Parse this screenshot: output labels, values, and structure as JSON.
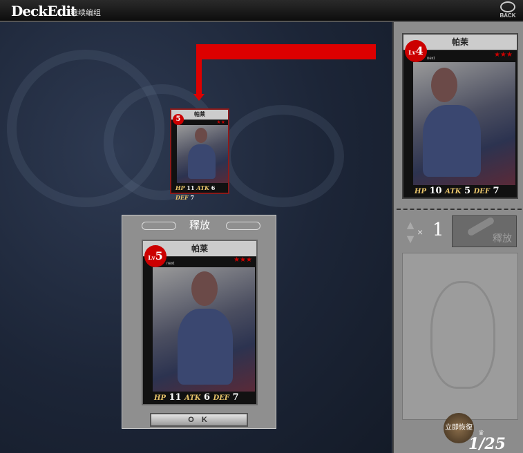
{
  "header": {
    "title": "DeckEdit",
    "subtitle": "继续编组",
    "back_label": "BACK"
  },
  "small_card": {
    "name": "帕莱",
    "level": "5",
    "hp": "11",
    "atk": "6",
    "def": "7",
    "stars": "★★"
  },
  "release_dialog": {
    "title": "釋放",
    "ok_label": "O K",
    "card": {
      "name": "帕莱",
      "level_prefix": "Lv",
      "level": "5",
      "next_label": "next",
      "hp_label": "HP",
      "hp": "11",
      "atk_label": "ATK",
      "atk": "6",
      "def_label": "DEF",
      "def": "7",
      "stars": "★★★"
    }
  },
  "side_card": {
    "name": "帕茉",
    "level_prefix": "Lv",
    "level": "4",
    "next_label": "next",
    "hp_label": "HP",
    "hp": "10",
    "atk_label": "ATK",
    "atk": "5",
    "def_label": "DEF",
    "def": "7",
    "stars": "★★★"
  },
  "release_panel": {
    "multiplier": "×",
    "count": "1",
    "release_label": "釋放"
  },
  "footer": {
    "restore_label": "立即恢復",
    "life": "1/25"
  },
  "colors": {
    "accent_red": "#dd0000",
    "background": "#1b2332",
    "panel": "#8c8c8c"
  }
}
